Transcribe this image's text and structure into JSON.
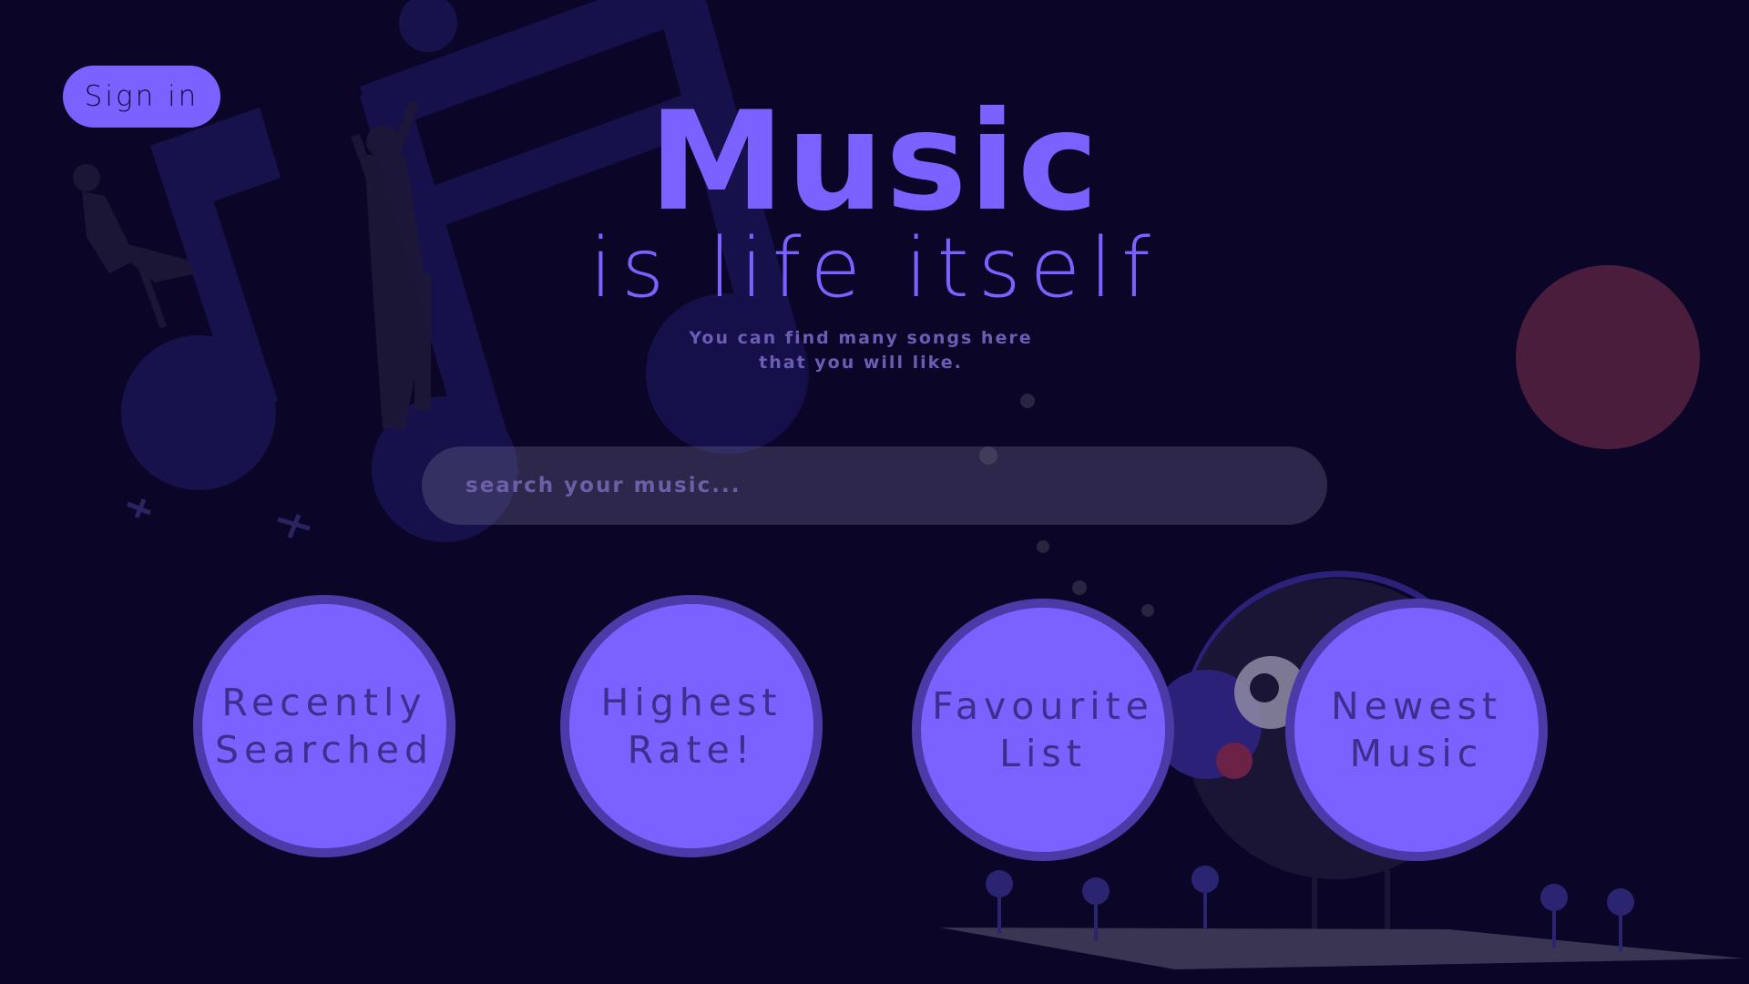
{
  "header": {
    "sign_in_label": "Sign in"
  },
  "hero": {
    "title": "Music",
    "subtitle": "is life itself",
    "tagline_line1": "You can find many songs here",
    "tagline_line2": "that you will like."
  },
  "search": {
    "placeholder": "search your music..."
  },
  "categories": [
    {
      "line1": "Recently",
      "line2": "Searched"
    },
    {
      "line1": "Highest",
      "line2": "Rate!"
    },
    {
      "line1": "Favourite",
      "line2": "List"
    },
    {
      "line1": "Newest",
      "line2": "Music"
    }
  ],
  "colors": {
    "background": "#0b0628",
    "accent": "#7b61ff",
    "accent_dark": "#4b3aa8",
    "decor_red": "#4a1d3c"
  },
  "icons": {
    "music_note": "music-note-illustration",
    "bird": "bird-with-headphones-illustration"
  }
}
